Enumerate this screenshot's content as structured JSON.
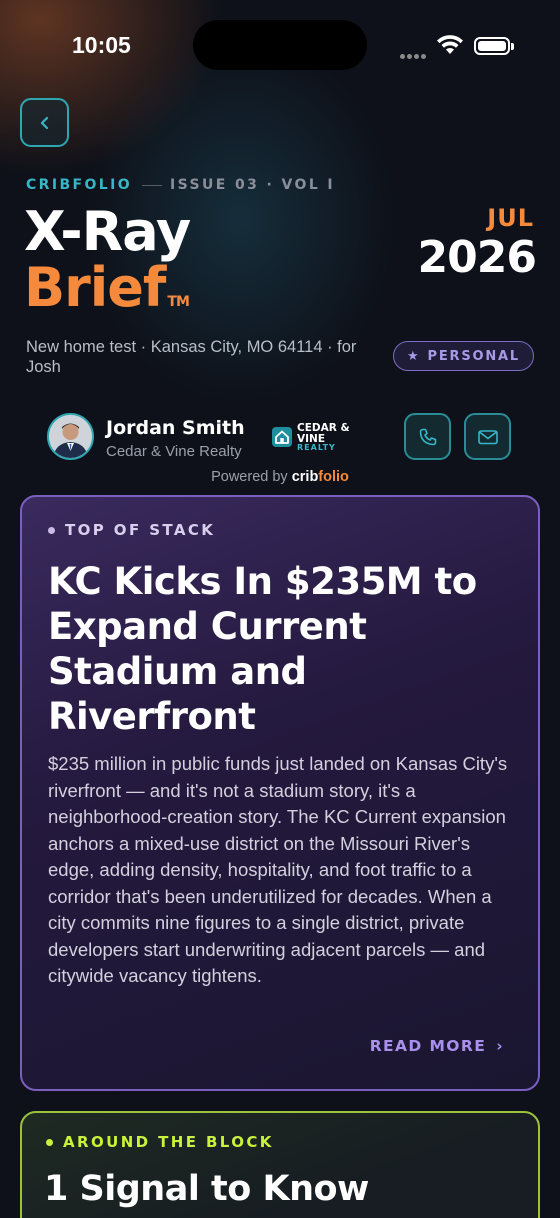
{
  "status_bar": {
    "time": "10:05"
  },
  "header": {
    "brand": "CRIBFOLIO",
    "issue": "ISSUE 03 · VOL I",
    "title_line1": "X-Ray",
    "title_line2": "Brief",
    "trademark": "TM",
    "month": "JUL",
    "year": "2026",
    "subtitle": "New home test · Kansas City, MO 64114 · for Josh",
    "badge": "PERSONAL"
  },
  "agent": {
    "name": "Jordan Smith",
    "company": "Cedar & Vine Realty",
    "logo_line1": "CEDAR &",
    "logo_line2": "VINE",
    "logo_line3": "REALTY"
  },
  "powered_by": {
    "prefix": "Powered by",
    "brand_part1": "crib",
    "brand_part2": "folio"
  },
  "feature_card": {
    "kicker": "TOP OF STACK",
    "headline": "KC Kicks In $235M to Expand Current Stadium and Riverfront",
    "body": "$235 million in public funds just landed on Kansas City's riverfront — and it's not a stadium story, it's a neighborhood-creation story. The KC Current expansion anchors a mixed-use district on the Missouri River's edge, adding density, hospitality, and foot traffic to a corridor that's been underutilized for decades. When a city commits nine figures to a single district, private developers start underwriting adjacent parcels — and citywide vacancy tightens.",
    "read_more": "READ MORE"
  },
  "second_card": {
    "kicker": "AROUND THE BLOCK",
    "title": "1 Signal to Know"
  },
  "colors": {
    "background": "#0e1119",
    "teal": "#37b6c8",
    "orange": "#f58a3d",
    "purple": "#7a5fc0",
    "lime": "#c9f23a"
  }
}
